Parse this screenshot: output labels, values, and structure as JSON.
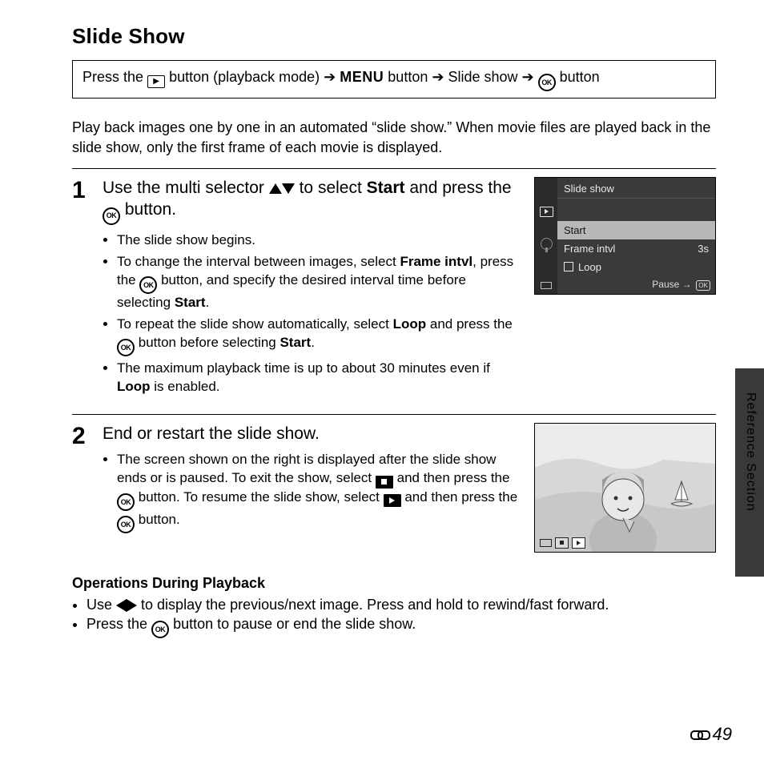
{
  "title": "Slide Show",
  "nav": {
    "p1": "Press the ",
    "p2": " button (playback mode) ",
    "arrow": "➔",
    "menu": "MENU",
    "p3": " button ",
    "p4": " Slide show ",
    "p5": " button"
  },
  "intro": "Play back images one by one in an automated “slide show.” When movie files are played back in the slide show, only the first frame of each movie is displayed.",
  "step1": {
    "num": "1",
    "head_a": "Use the multi selector ",
    "head_b": " to select ",
    "head_sel": "Start",
    "head_c": " and press the ",
    "head_d": " button.",
    "b1": "The slide show begins.",
    "b2a": "To change the interval between images, select ",
    "b2_fi": "Frame intvl",
    "b2b": ", press the ",
    "b2c": " button, and specify the desired interval time before selecting ",
    "b2_start": "Start",
    "b2d": ".",
    "b3a": "To repeat the slide show automatically, select ",
    "b3_loop": "Loop",
    "b3b": " and press the ",
    "b3c": " button before selecting ",
    "b3_start": "Start",
    "b3d": ".",
    "b4a": "The maximum playback time is up to about 30 minutes even if ",
    "b4_loop": "Loop",
    "b4b": " is enabled."
  },
  "lcd": {
    "title": "Slide show",
    "start": "Start",
    "frame": "Frame intvl",
    "frame_val": "3s",
    "loop": "Loop",
    "pause": "Pause",
    "ok": "OK"
  },
  "step2": {
    "num": "2",
    "head": "End or restart the slide show.",
    "b1a": "The screen shown on the right is displayed after the slide show ends or is paused. To exit the show, select ",
    "b1b": " and then press the ",
    "b1c": " button. To resume the slide show, select ",
    "b1d": " and then press the ",
    "b1e": " button."
  },
  "ops": {
    "head": "Operations During Playback",
    "l1a": "Use ",
    "l1b": " to display the previous/next image. Press and hold to rewind/fast forward.",
    "l2a": "Press the ",
    "l2b": " button to pause or end the slide show."
  },
  "side_label": "Reference Section",
  "page_number": "49",
  "ok_label": "OK"
}
